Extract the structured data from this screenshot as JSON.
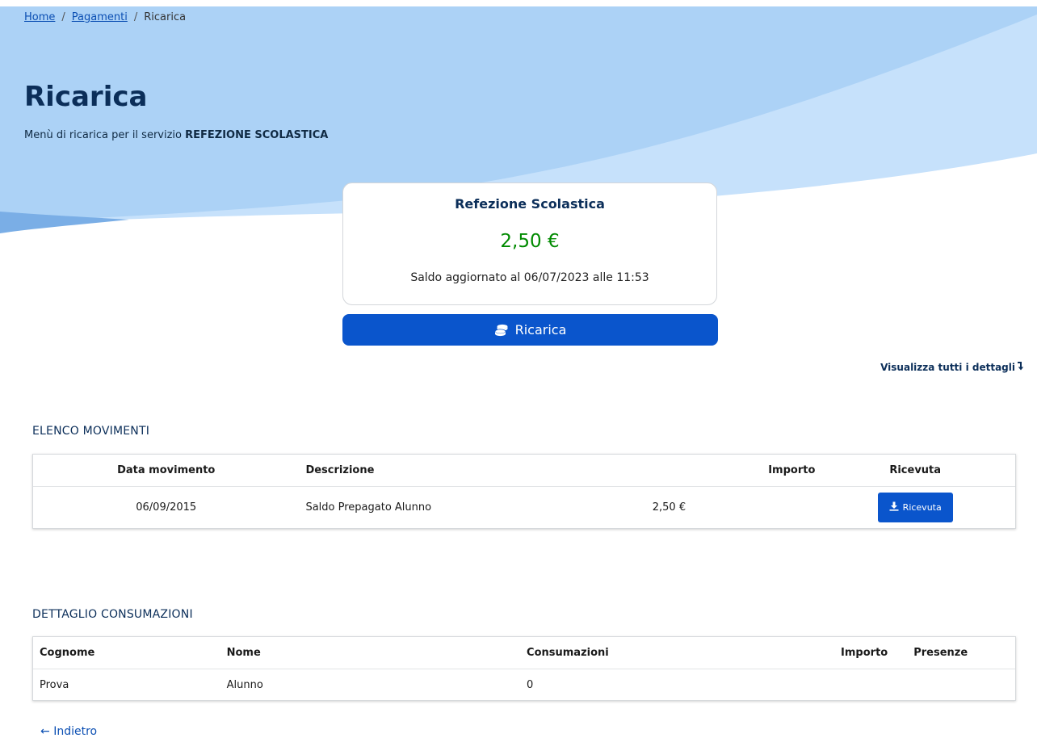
{
  "breadcrumb": {
    "home": "Home",
    "payments": "Pagamenti",
    "current": "Ricarica",
    "separator": "/"
  },
  "page": {
    "title": "Ricarica",
    "subtitle_prefix": "Menù di ricarica per il servizio ",
    "subtitle_service": "REFEZIONE SCOLASTICA"
  },
  "balance_card": {
    "service_name": "Refezione Scolastica",
    "amount": "2,50 €",
    "updated_text": "Saldo aggiornato al 06/07/2023 alle 11:53"
  },
  "recharge_button": {
    "label": "Ricarica",
    "icon": "coins-icon"
  },
  "details_link": {
    "label": "Visualizza tutti i dettagli",
    "icon": "arrow-down-turn-icon"
  },
  "movements": {
    "title": "ELENCO MOVIMENTI",
    "columns": [
      "Data movimento",
      "Descrizione",
      "Importo",
      "Ricevuta"
    ],
    "rows": [
      {
        "date": "06/09/2015",
        "description": "Saldo Prepagato Alunno",
        "amount": "2,50 €",
        "receipt_label": "Ricevuta"
      }
    ]
  },
  "consumptions": {
    "title": "DETTAGLIO CONSUMAZIONI",
    "columns": [
      "Cognome",
      "Nome",
      "Consumazioni",
      "Importo",
      "Presenze"
    ],
    "rows": [
      {
        "surname": "Prova",
        "name": "Alunno",
        "consumptions": "0",
        "amount": "",
        "attendance": ""
      }
    ]
  },
  "back_link": {
    "label": "Indietro",
    "arrow": "←"
  },
  "colors": {
    "hero_light": "#c6e1fb",
    "hero_mid": "#a9cff5",
    "primary_button": "#0a55cc",
    "title_navy": "#0b2e59",
    "amount_green": "#008a00"
  }
}
